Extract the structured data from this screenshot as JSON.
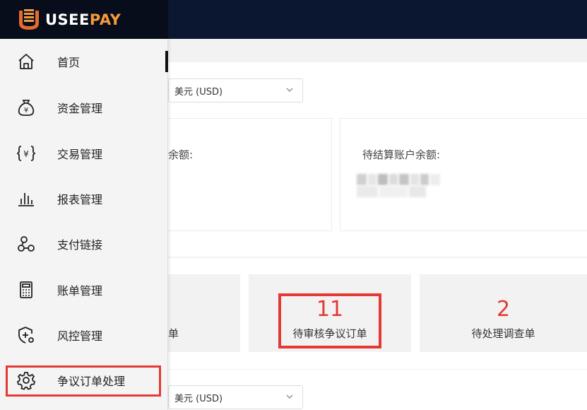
{
  "brand": {
    "name_part1": "USEE",
    "name_part2": "PAY",
    "accent": "#f39a3d"
  },
  "sidebar": {
    "items": [
      {
        "label": "首页",
        "icon": "home-icon"
      },
      {
        "label": "资金管理",
        "icon": "money-bag-icon"
      },
      {
        "label": "交易管理",
        "icon": "transaction-icon"
      },
      {
        "label": "报表管理",
        "icon": "bar-chart-icon"
      },
      {
        "label": "支付链接",
        "icon": "link-icon"
      },
      {
        "label": "账单管理",
        "icon": "calculator-icon"
      },
      {
        "label": "风控管理",
        "icon": "shield-plus-icon"
      },
      {
        "label": "争议订单处理",
        "icon": "gear-icon"
      }
    ]
  },
  "main": {
    "currency_select_top": {
      "value": "美元 (USD)"
    },
    "balance_card_left": {
      "label": "余额:"
    },
    "balance_card_right": {
      "label": "待结算账户余额:"
    },
    "stats": [
      {
        "label": "单"
      },
      {
        "number": "11",
        "label": "待审核争议订单"
      },
      {
        "number": "2",
        "label": "待处理调查单"
      }
    ],
    "currency_select_bottom": {
      "value": "美元 (USD)"
    }
  },
  "colors": {
    "topbar": "#0b1730",
    "highlight": "#e53935",
    "stat_number": "#e53935"
  }
}
